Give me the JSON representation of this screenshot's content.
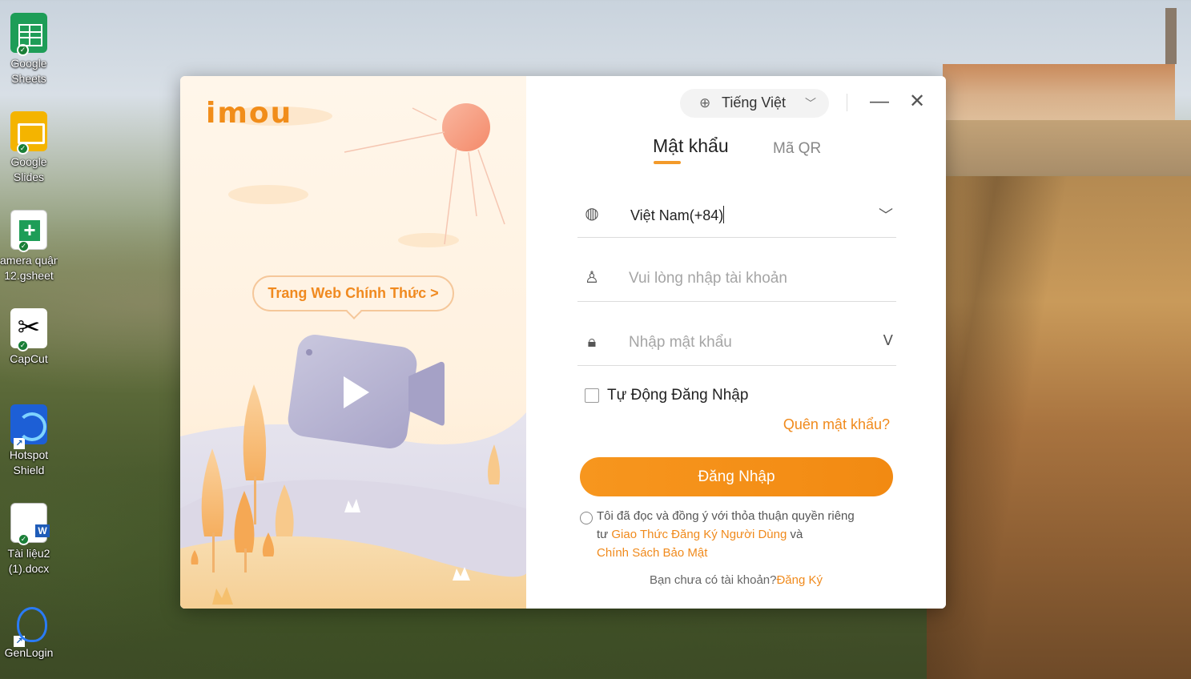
{
  "desktop": {
    "icons": [
      {
        "label_line1": "Google",
        "label_line2": "Sheets"
      },
      {
        "label_line1": "Google",
        "label_line2": "Slides"
      },
      {
        "label_line1": "amera quận",
        "label_line2": "12.gsheet"
      },
      {
        "label_line1": "CapCut",
        "label_line2": ""
      },
      {
        "label_line1": "Hotspot",
        "label_line2": "Shield"
      },
      {
        "label_line1": "Tài liệu2",
        "label_line2": "(1).docx"
      },
      {
        "label_line1": "GenLogin",
        "label_line2": ""
      }
    ]
  },
  "app": {
    "logo": "imou",
    "official_site_button": "Trang Web Chính Thức >",
    "language": {
      "selected": "Tiếng Việt",
      "icon": "globe-icon"
    },
    "window_controls": {
      "minimize": "—",
      "close": "✕"
    },
    "tabs": [
      {
        "label": "Mật khẩu",
        "active": true
      },
      {
        "label": "Mã QR",
        "active": false
      }
    ],
    "country_field": {
      "value": "Việt Nam(+84)",
      "icon": "globe-icon"
    },
    "account_field": {
      "placeholder": "Vui lòng nhập tài khoản",
      "value": "",
      "icon": "user-icon"
    },
    "password_field": {
      "placeholder": "Nhập mật khẩu",
      "value": "",
      "icon": "lock-icon"
    },
    "auto_login": {
      "label": "Tự Động Đăng Nhập",
      "checked": false
    },
    "forgot_password": "Quên mật khẩu?",
    "login_button": "Đăng Nhập",
    "agreement": {
      "prefix": "Tôi đã đọc và đồng ý với thỏa thuận quyền riêng tư ",
      "terms_link": "Giao Thức Đăng Ký Người Dùng",
      "conjunction": " và",
      "privacy_link": "Chính Sách Bảo Mật",
      "checked": false
    },
    "signup": {
      "prompt": "Bạn chưa có tài khoản?",
      "link": "Đăng Ký"
    },
    "colors": {
      "accent": "#f28a12",
      "link": "#f08a1c"
    }
  }
}
